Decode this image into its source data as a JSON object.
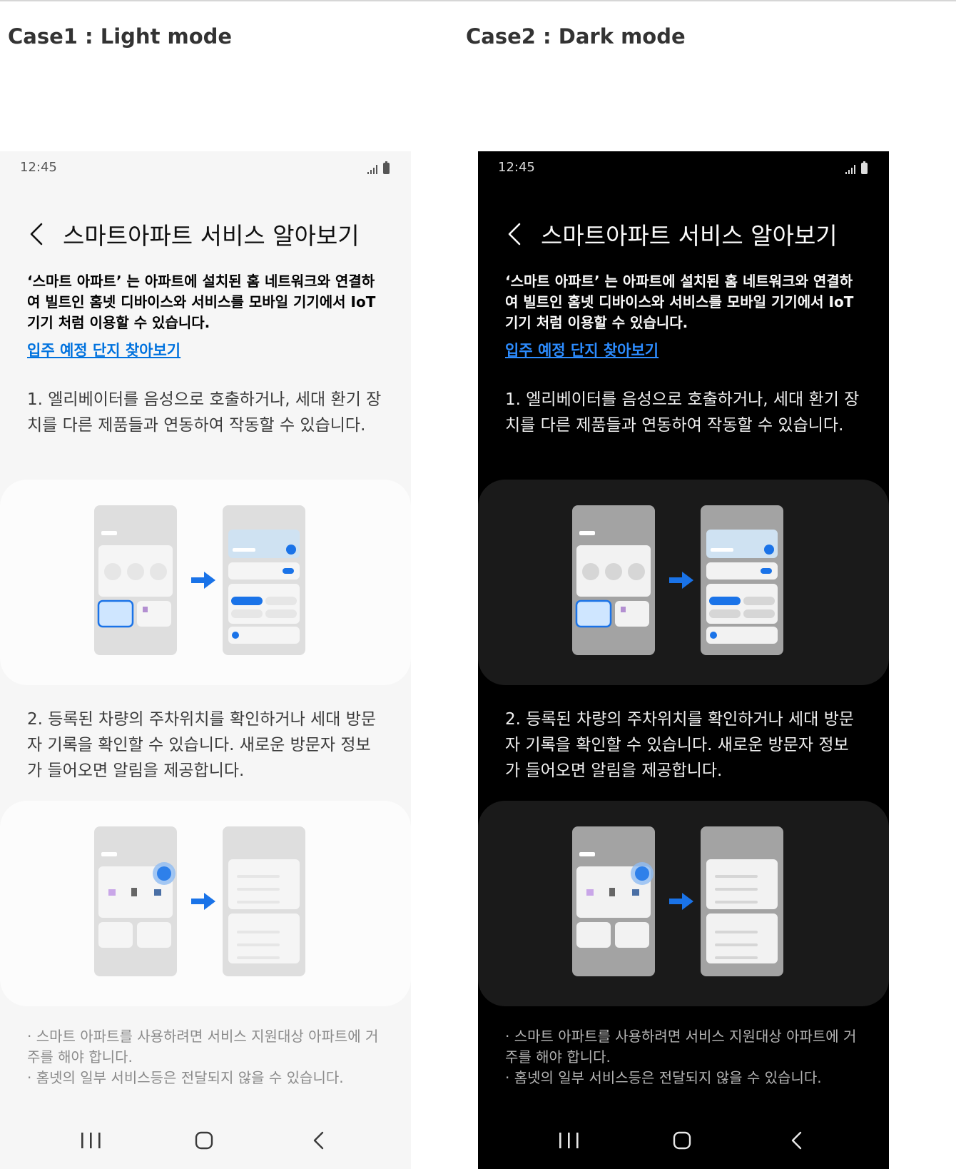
{
  "cases": [
    {
      "title": "Case1 : Light mode",
      "mode": "light",
      "accent": "#0072de",
      "status": {
        "time": "12:45"
      },
      "header": {
        "title": "스마트아파트 서비스 알아보기"
      },
      "intro": "‘스마트 아파트’ 는 아파트에 설치된 홈 네트워크와 연결하여 빌트인 홈넷 디바이스와 서비스를 모바일 기기에서 IoT 기기 처럼 이용할 수 있습니다.",
      "link": "입주 예정 단지 찾아보기",
      "feature1": "1. 엘리베이터를 음성으로 호출하거나, 세대 환기 장치를 다른 제품들과 연동하여 작동할 수 있습니다.",
      "feature2": "2. 등록된 차량의 주차위치를 확인하거나 세대 방문자 기록을 확인할 수 있습니다. 새로운 방문자 정보가 들어오면 알림을 제공합니다.",
      "notes": [
        "· 스마트 아파트를 사용하려면 서비스 지원대상 아파트에 거주를 해야 합니다.",
        "· 홈넷의 일부 서비스등은 전달되지 않을 수 있습니다."
      ]
    },
    {
      "title": "Case2 : Dark mode",
      "mode": "dark",
      "accent": "#2c8cff",
      "status": {
        "time": "12:45"
      },
      "header": {
        "title": "스마트아파트 서비스 알아보기"
      },
      "intro": "‘스마트 아파트’ 는 아파트에 설치된 홈 네트워크와 연결하여 빌트인 홈넷 디바이스와 서비스를 모바일 기기에서 IoT 기기 처럼 이용할 수 있습니다.",
      "link": "입주 예정 단지 찾아보기",
      "feature1": "1. 엘리베이터를 음성으로 호출하거나, 세대 환기 장치를 다른 제품들과 연동하여 작동할 수 있습니다.",
      "feature2": "2. 등록된 차량의 주차위치를 확인하거나 세대 방문자 기록을 확인할 수 있습니다. 새로운 방문자 정보가 들어오면 알림을 제공합니다.",
      "notes": [
        "· 스마트 아파트를 사용하려면 서비스 지원대상 아파트에 거주를 해야 합니다.",
        "· 홈넷의 일부 서비스등은 전달되지 않을 수 있습니다."
      ]
    }
  ],
  "icons": {
    "back": "chevron-left-icon",
    "signal": "signal-icon",
    "battery": "battery-icon",
    "recent": "recent-apps-icon",
    "home": "home-icon",
    "nav_back": "nav-back-icon",
    "arrow": "arrow-right-icon"
  }
}
